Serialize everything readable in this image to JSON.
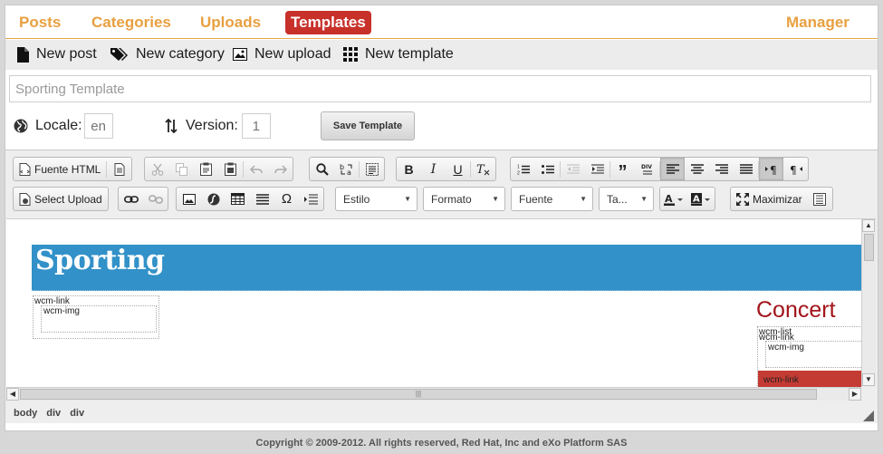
{
  "nav": {
    "posts": "Posts",
    "categories": "Categories",
    "uploads": "Uploads",
    "templates": "Templates",
    "manager": "Manager"
  },
  "actions": {
    "new_post": "New post",
    "new_category": "New category",
    "new_upload": "New upload",
    "new_template": "New template"
  },
  "form": {
    "name_placeholder": "Sporting Template",
    "locale_label": "Locale:",
    "locale_placeholder": "en",
    "version_label": "Version:",
    "version_placeholder": "1",
    "save_label": "Save Template"
  },
  "toolbar": {
    "source_label": "Fuente HTML",
    "select_upload_label": "Select Upload",
    "maximize_label": "Maximizar",
    "combos": {
      "style": "Estilo",
      "format": "Formato",
      "font": "Fuente",
      "size": "Ta..."
    }
  },
  "content": {
    "banner_title": "Sporting",
    "wcm_link": "wcm-link",
    "wcm_img": "wcm-img",
    "concert_title": "Concert",
    "wcm_list": "wcm-list",
    "wcm_link_2": "wcm-link",
    "wcm_img_2": "wcm-img",
    "wcm_link_3": "wcm-link"
  },
  "path": [
    "body",
    "div",
    "div"
  ],
  "footer": "Copyright © 2009-2012. All rights reserved, Red Hat, Inc and eXo Platform SAS",
  "colors": {
    "nav_accent": "#e8a040",
    "active_tab": "#c8302a",
    "banner": "#3291c8",
    "concert": "#a3141a"
  }
}
